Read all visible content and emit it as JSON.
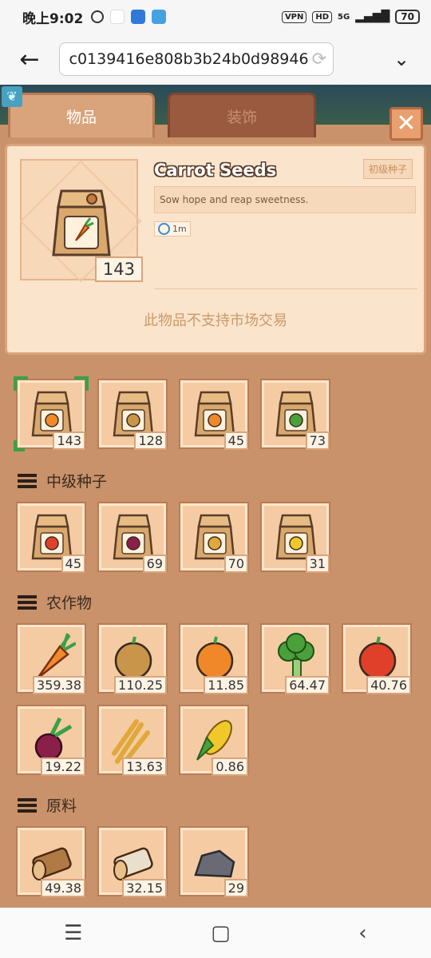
{
  "status_bar": {
    "time": "晚上9:02",
    "vpn": "VPN",
    "hd": "HD",
    "network": "5G",
    "battery": "70"
  },
  "browser": {
    "url": "ac0139416e808b3b24b0d98946"
  },
  "game": {
    "tabs": {
      "items": "物品",
      "decor": "装饰"
    },
    "detail": {
      "name": "Carrot Seeds",
      "tier": "初级种子",
      "description": "Sow hope and reap sweetness.",
      "time": "1m",
      "count": "143",
      "market_note": "此物品不支持市场交易"
    },
    "beginner_seeds": [
      {
        "icon": "carrot-seed-bag-icon",
        "count": "143"
      },
      {
        "icon": "potato-seed-bag-icon",
        "count": "128"
      },
      {
        "icon": "pumpkin-seed-bag-icon",
        "count": "45"
      },
      {
        "icon": "broccoli-seed-bag-icon",
        "count": "73"
      }
    ],
    "section_mid_seeds": "中级种子",
    "mid_seeds": [
      {
        "icon": "tomato-seed-bag-icon",
        "count": "45"
      },
      {
        "icon": "beet-seed-bag-icon",
        "count": "69"
      },
      {
        "icon": "wheat-seed-bag-icon",
        "count": "70"
      },
      {
        "icon": "corn-seed-bag-icon",
        "count": "31"
      }
    ],
    "section_crops": "农作物",
    "crops": [
      {
        "icon": "carrot-icon",
        "count": "359.38"
      },
      {
        "icon": "potato-icon",
        "count": "110.25"
      },
      {
        "icon": "pumpkin-icon",
        "count": "11.85"
      },
      {
        "icon": "broccoli-icon",
        "count": "64.47"
      },
      {
        "icon": "tomato-icon",
        "count": "40.76"
      },
      {
        "icon": "beet-icon",
        "count": "19.22"
      },
      {
        "icon": "wheat-icon",
        "count": "13.63"
      },
      {
        "icon": "corn-icon",
        "count": "0.86"
      }
    ],
    "section_materials": "原料",
    "materials": [
      {
        "icon": "log-icon",
        "count": "49.38"
      },
      {
        "icon": "birch-log-icon",
        "count": "32.15"
      },
      {
        "icon": "stone-icon",
        "count": "29"
      }
    ]
  }
}
